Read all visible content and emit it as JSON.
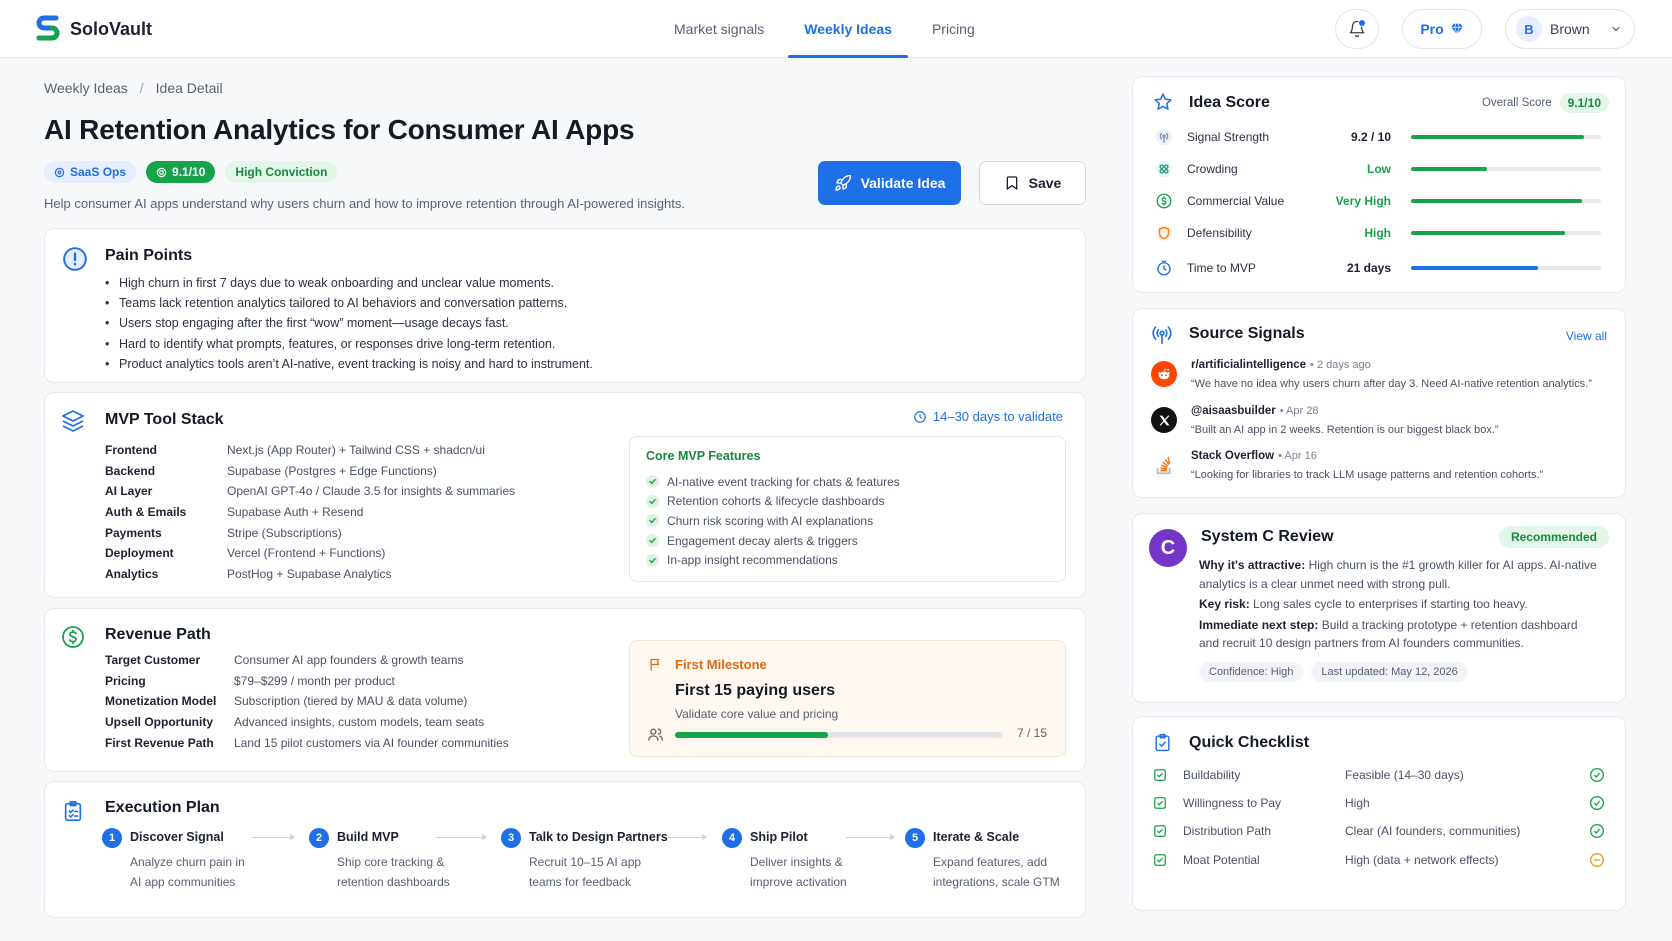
{
  "app": {
    "name": "SoloVault"
  },
  "nav": {
    "items": [
      {
        "label": "Market signals"
      },
      {
        "label": "Weekly Ideas",
        "active": true
      },
      {
        "label": "Pricing"
      }
    ]
  },
  "header": {
    "plan_label": "Pro",
    "user": {
      "initial": "B",
      "name": "Brown"
    }
  },
  "breadcrumb": {
    "parent": "Weekly Ideas",
    "separator": "/",
    "current": "Idea Detail"
  },
  "idea": {
    "title": "AI Retention Analytics for Consumer AI Apps",
    "tags": {
      "category": "SaaS Ops",
      "score": "9.1/10",
      "conviction": "High Conviction"
    },
    "subtitle": "Help consumer AI apps understand why users churn and how to improve retention through AI-powered insights.",
    "validate_label": "Validate Idea",
    "save_label": "Save"
  },
  "pain_points": {
    "title": "Pain Points",
    "items": [
      "High churn in first 7 days due to weak onboarding and unclear value moments.",
      "Teams lack retention analytics tailored to AI behaviors and conversation patterns.",
      "Users stop engaging after the first “wow” moment—usage decays fast.",
      "Hard to identify what prompts, features, or responses drive long-term retention.",
      "Product analytics tools aren’t AI-native, event tracking is noisy and hard to instrument."
    ]
  },
  "mvp": {
    "title": "MVP Tool Stack",
    "validate_time": "14–30 days to validate",
    "stack": [
      {
        "key": "Frontend",
        "value": "Next.js (App Router) + Tailwind CSS + shadcn/ui"
      },
      {
        "key": "Backend",
        "value": "Supabase (Postgres + Edge Functions)"
      },
      {
        "key": "AI Layer",
        "value": "OpenAI GPT-4o / Claude 3.5 for insights & summaries"
      },
      {
        "key": "Auth & Emails",
        "value": "Supabase Auth + Resend"
      },
      {
        "key": "Payments",
        "value": "Stripe (Subscriptions)"
      },
      {
        "key": "Deployment",
        "value": "Vercel (Frontend + Functions)"
      },
      {
        "key": "Analytics",
        "value": "PostHog + Supabase Analytics"
      }
    ],
    "features_title": "Core MVP Features",
    "features": [
      "AI-native event tracking for chats & features",
      "Retention cohorts & lifecycle dashboards",
      "Churn risk scoring with AI explanations",
      "Engagement decay alerts & triggers",
      "In-app insight recommendations"
    ]
  },
  "revenue": {
    "title": "Revenue Path",
    "rows": [
      {
        "key": "Target Customer",
        "value": "Consumer AI app founders & growth teams"
      },
      {
        "key": "Pricing",
        "value": "$79–$299 / month per product"
      },
      {
        "key": "Monetization Model",
        "value": "Subscription (tiered by MAU & data volume)"
      },
      {
        "key": "Upsell Opportunity",
        "value": "Advanced insights, custom models, team seats"
      },
      {
        "key": "First Revenue Path",
        "value": "Land 15 pilot customers via AI founder communities"
      }
    ],
    "milestone": {
      "label": "First Milestone",
      "title": "First 15 paying users",
      "subtitle": "Validate core value and pricing",
      "progress": 0.467,
      "count": "7 / 15"
    }
  },
  "execution": {
    "title": "Execution Plan",
    "steps": [
      {
        "num": "1",
        "title": "Discover Signal",
        "desc": "Analyze churn pain in AI app communities"
      },
      {
        "num": "2",
        "title": "Build MVP",
        "desc": "Ship core tracking & retention dashboards"
      },
      {
        "num": "3",
        "title": "Talk to Design Partners",
        "desc": "Recruit 10–15 AI app teams for feedback"
      },
      {
        "num": "4",
        "title": "Ship Pilot",
        "desc": "Deliver insights & improve activation"
      },
      {
        "num": "5",
        "title": "Iterate & Scale",
        "desc": "Expand features, add integrations, scale GTM"
      }
    ]
  },
  "score": {
    "title": "Idea Score",
    "overall_label": "Overall Score",
    "overall_value": "9.1/10",
    "rows": [
      {
        "label": "Signal Strength",
        "value": "9.2 / 10",
        "level": 0.91,
        "color": "#17a34a",
        "value_color": "#1c2230",
        "icon": "signal-icon"
      },
      {
        "label": "Crowding",
        "value": "Low",
        "level": 0.4,
        "color": "#17a34a",
        "value_color": "#17a34a",
        "icon": "crowding-icon"
      },
      {
        "label": "Commercial Value",
        "value": "Very High",
        "level": 0.9,
        "color": "#17a34a",
        "value_color": "#17a34a",
        "icon": "dollar-icon"
      },
      {
        "label": "Defensibility",
        "value": "High",
        "level": 0.81,
        "color": "#17a34a",
        "value_color": "#17a34a",
        "icon": "shield-icon"
      },
      {
        "label": "Time to MVP",
        "value": "21 days",
        "level": 0.67,
        "color": "#1f6fe8",
        "value_color": "#1c2230",
        "icon": "clock-icon"
      }
    ]
  },
  "signals": {
    "title": "Source Signals",
    "view_all": "View all",
    "items": [
      {
        "source": "r/artificialintelligence",
        "time": "2 days ago",
        "quote": "“We have no idea why users churn after day 3. Need AI-native retention analytics.”",
        "icon": "reddit-icon"
      },
      {
        "source": "@aisaasbuilder",
        "time": "Apr 28",
        "quote": "“Built an AI app in 2 weeks. Retention is our biggest black box.”",
        "icon": "x-icon"
      },
      {
        "source": "Stack Overflow",
        "time": "Apr 16",
        "quote": "“Looking for libraries to track LLM usage patterns and retention cohorts.”",
        "icon": "stackoverflow-icon"
      }
    ]
  },
  "review": {
    "avatar": "C",
    "title": "System C Review",
    "badge": "Recommended",
    "attractive_label": "Why it's attractive:",
    "attractive_text": "High churn is the #1 growth killer for AI apps. AI-native analytics is a clear unmet need with strong pull.",
    "risk_label": "Key risk:",
    "risk_text": "Long sales cycle to enterprises if starting too heavy.",
    "next_label": "Immediate next step:",
    "next_text": "Build a tracking prototype + retention dashboard and recruit 10 design partners from AI founders communities.",
    "confidence": "Confidence: High",
    "updated": "Last updated: May 12, 2026"
  },
  "checklist": {
    "title": "Quick Checklist",
    "items": [
      {
        "name": "Buildability",
        "value": "Feasible (14–30 days)",
        "status": "pass"
      },
      {
        "name": "Willingness to Pay",
        "value": "High",
        "status": "pass"
      },
      {
        "name": "Distribution Path",
        "value": "Clear (AI founders, communities)",
        "status": "pass"
      },
      {
        "name": "Moat Potential",
        "value": "High (data + network effects)",
        "status": "partial"
      }
    ]
  }
}
